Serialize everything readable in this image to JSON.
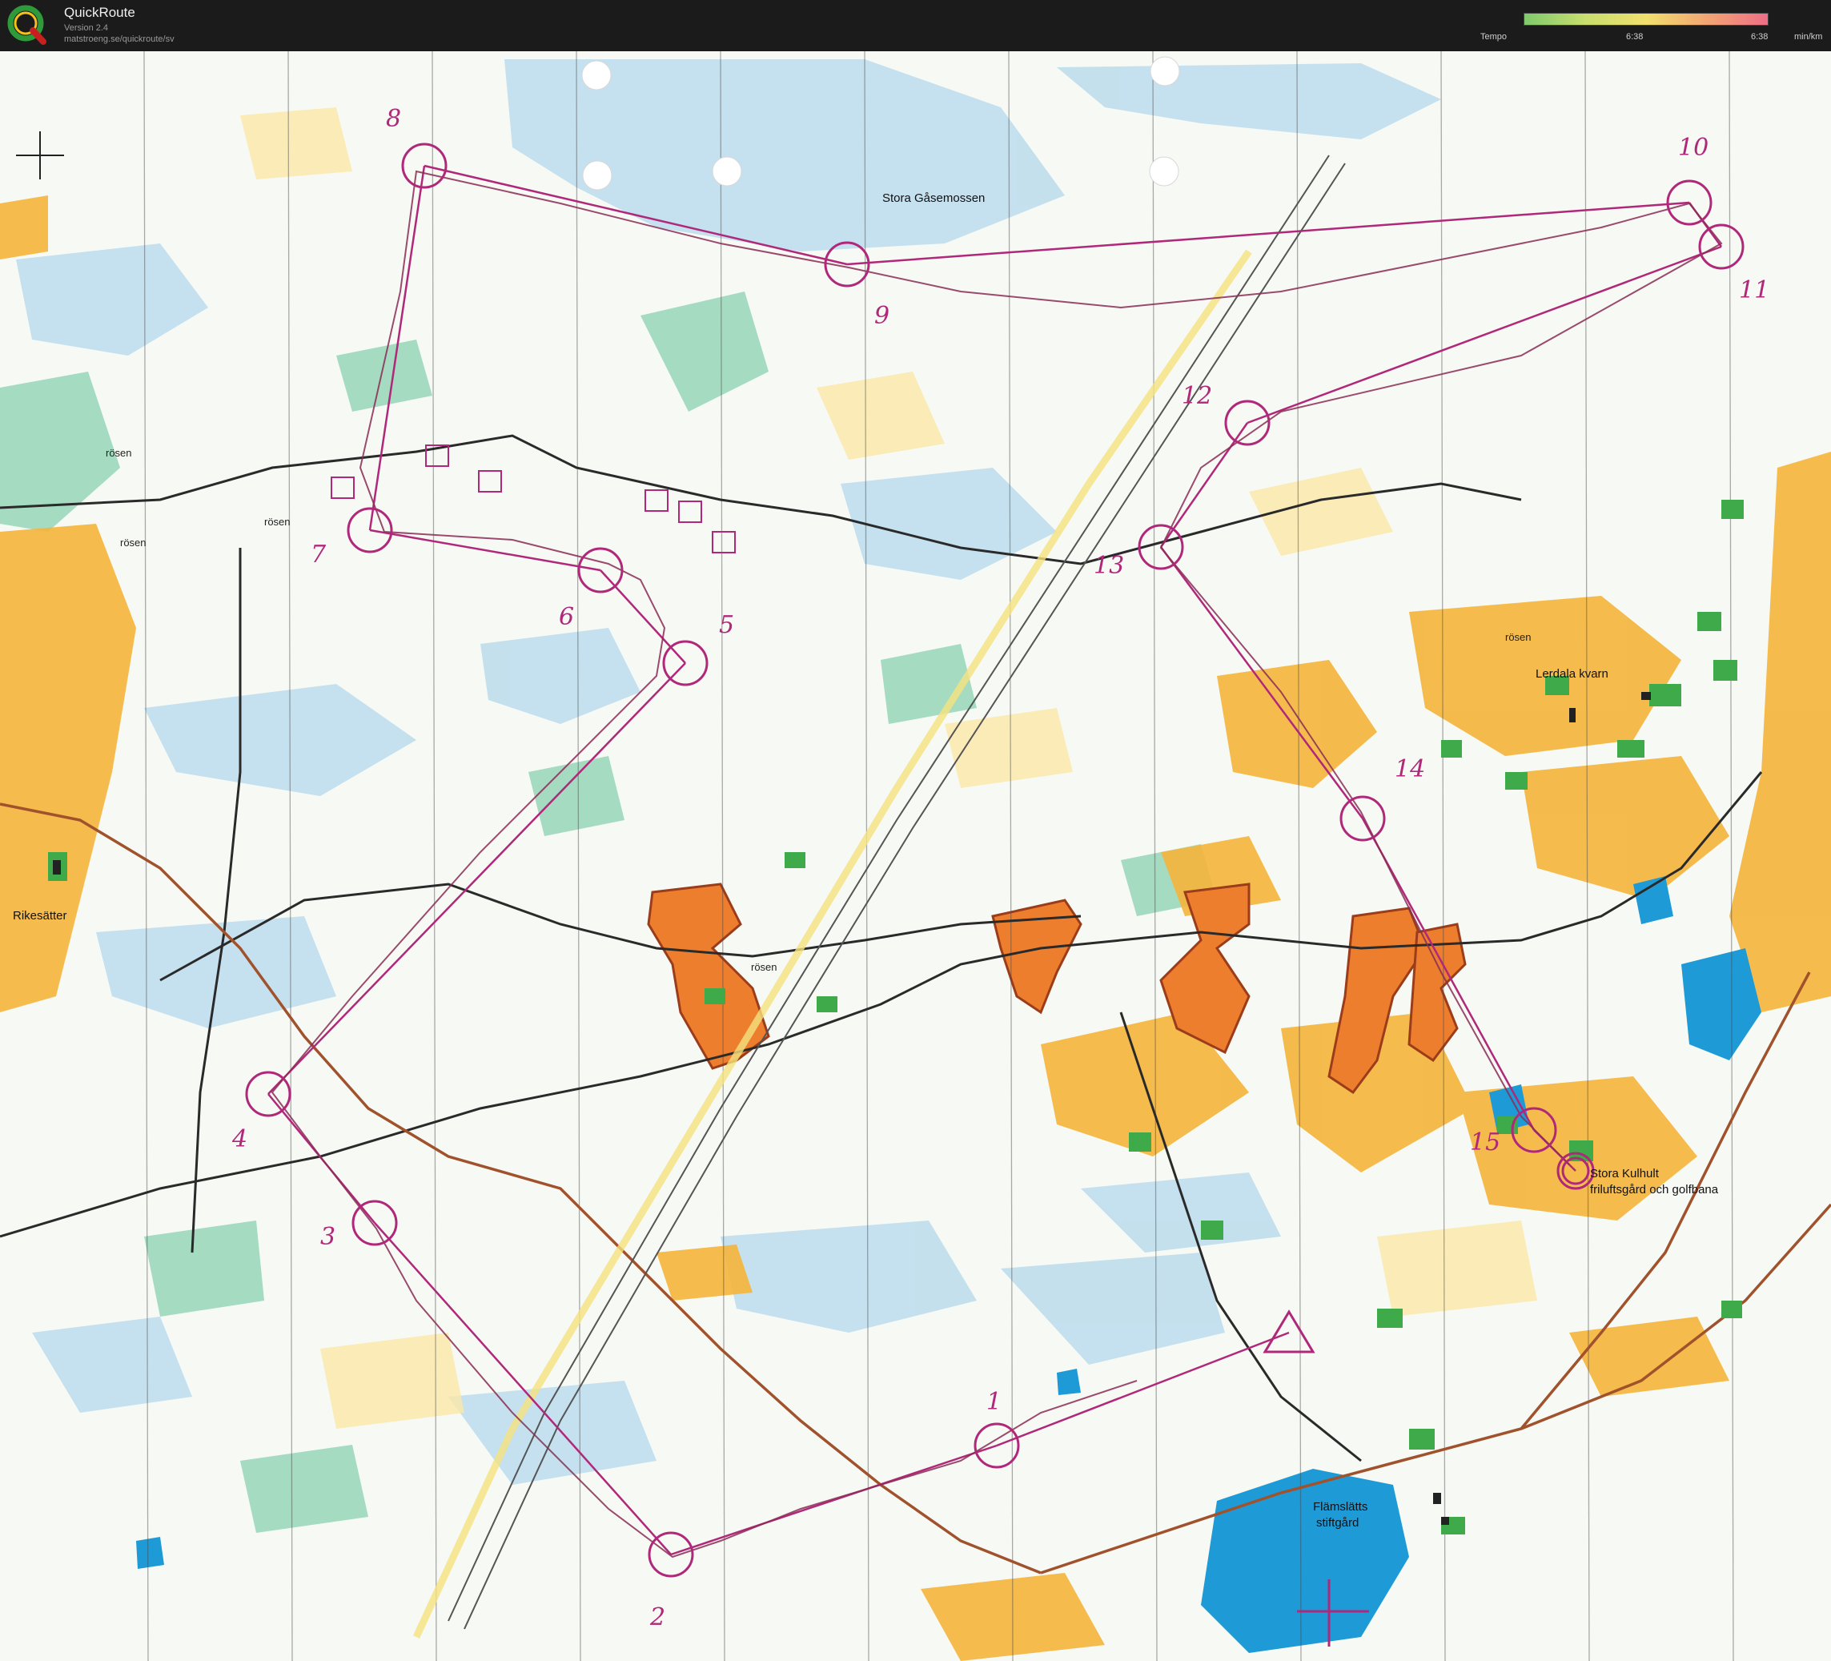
{
  "header": {
    "app_title": "QuickRoute",
    "version": "Version 2.4",
    "url": "matstroeng.se/quickroute/sv",
    "tempo_label": "Tempo",
    "tempo_mid": "6:38",
    "tempo_max": "6:38",
    "tempo_unit": "min/km"
  },
  "map": {
    "place_names": {
      "stora_gasemossen": "Stora Gåsemossen",
      "lerdala_kvarn": "Lerdala kvarn",
      "rikesatter": "Rikesätter",
      "stora_kulhult_1": "Stora Kulhult",
      "stora_kulhult_2": "friluftsgård och golfbana",
      "flamslatts_1": "Flämslätts",
      "flamslatts_2": "stiftgård",
      "rosen_1": "rösen",
      "rosen_2": "rösen",
      "rosen_3": "rösen",
      "rosen_4": "rösen",
      "rosen_5": "rösen"
    },
    "controls": [
      {
        "number": "1"
      },
      {
        "number": "2"
      },
      {
        "number": "3"
      },
      {
        "number": "4"
      },
      {
        "number": "5"
      },
      {
        "number": "6"
      },
      {
        "number": "7"
      },
      {
        "number": "8"
      },
      {
        "number": "9"
      },
      {
        "number": "10"
      },
      {
        "number": "11"
      },
      {
        "number": "12"
      },
      {
        "number": "13"
      },
      {
        "number": "14"
      },
      {
        "number": "15"
      }
    ],
    "course_color": "#b0287a",
    "route_color": "#8a2d55"
  }
}
